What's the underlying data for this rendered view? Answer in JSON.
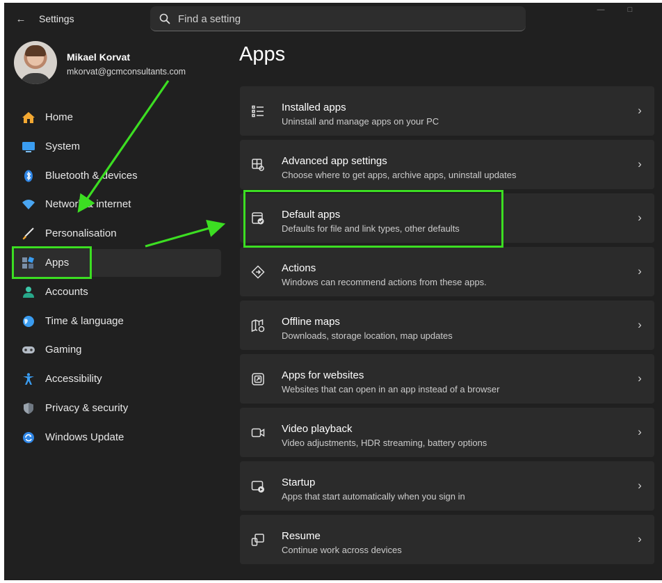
{
  "window": {
    "app_title": "Settings",
    "search": {
      "placeholder": "Find a setting"
    }
  },
  "profile": {
    "name": "Mikael Korvat",
    "email": "mkorvat@gcmconsultants.com"
  },
  "sidebar": {
    "items": [
      {
        "label": "Home",
        "icon": "home-icon",
        "selected": false
      },
      {
        "label": "System",
        "icon": "system-icon",
        "selected": false
      },
      {
        "label": "Bluetooth & devices",
        "icon": "bluetooth-icon",
        "selected": false
      },
      {
        "label": "Network & internet",
        "icon": "network-icon",
        "selected": false
      },
      {
        "label": "Personalisation",
        "icon": "brush-icon",
        "selected": false
      },
      {
        "label": "Apps",
        "icon": "apps-icon",
        "selected": true
      },
      {
        "label": "Accounts",
        "icon": "accounts-icon",
        "selected": false
      },
      {
        "label": "Time & language",
        "icon": "globe-icon",
        "selected": false
      },
      {
        "label": "Gaming",
        "icon": "gamepad-icon",
        "selected": false
      },
      {
        "label": "Accessibility",
        "icon": "accessibility-icon",
        "selected": false
      },
      {
        "label": "Privacy & security",
        "icon": "shield-icon",
        "selected": false
      },
      {
        "label": "Windows Update",
        "icon": "update-icon",
        "selected": false
      }
    ]
  },
  "main": {
    "title": "Apps",
    "cards": [
      {
        "title": "Installed apps",
        "description": "Uninstall and manage apps on your PC",
        "icon": "list-icon"
      },
      {
        "title": "Advanced app settings",
        "description": "Choose where to get apps, archive apps, uninstall updates",
        "icon": "app-settings-icon"
      },
      {
        "title": "Default apps",
        "description": "Defaults for file and link types, other defaults",
        "icon": "default-apps-icon"
      },
      {
        "title": "Actions",
        "description": "Windows can recommend actions from these apps.",
        "icon": "actions-icon"
      },
      {
        "title": "Offline maps",
        "description": "Downloads, storage location, map updates",
        "icon": "map-icon"
      },
      {
        "title": "Apps for websites",
        "description": "Websites that can open in an app instead of a browser",
        "icon": "app-website-icon"
      },
      {
        "title": "Video playback",
        "description": "Video adjustments, HDR streaming, battery options",
        "icon": "video-icon"
      },
      {
        "title": "Startup",
        "description": "Apps that start automatically when you sign in",
        "icon": "startup-icon"
      },
      {
        "title": "Resume",
        "description": "Continue work across devices",
        "icon": "resume-icon"
      }
    ]
  },
  "colors": {
    "background": "#202020",
    "card": "#2b2b2b",
    "annotation": "#3cde22",
    "accent": "#3a9cf0"
  }
}
